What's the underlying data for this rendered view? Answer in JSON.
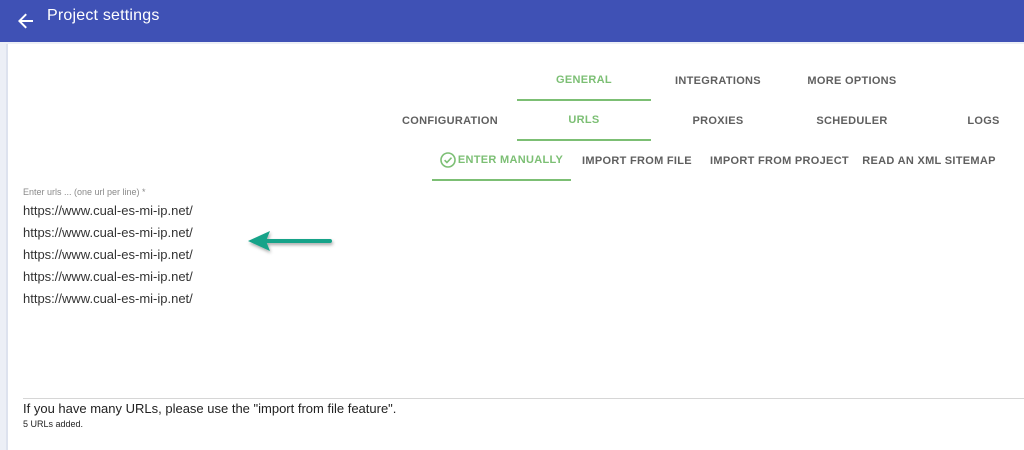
{
  "header": {
    "title": "Project settings",
    "bg_color": "#3f51b5"
  },
  "tabs_primary": [
    {
      "label": "GENERAL",
      "active": true
    },
    {
      "label": "INTEGRATIONS",
      "active": false
    },
    {
      "label": "MORE OPTIONS",
      "active": false
    }
  ],
  "tabs_secondary": [
    {
      "label": "CONFIGURATION",
      "active": false
    },
    {
      "label": "URLS",
      "active": true
    },
    {
      "label": "PROXIES",
      "active": false
    },
    {
      "label": "SCHEDULER",
      "active": false
    },
    {
      "label": "LOGS",
      "active": false
    }
  ],
  "tabs_tertiary": [
    {
      "label": "ENTER MANUALLY",
      "active": true,
      "icon": "check-circle-icon"
    },
    {
      "label": "IMPORT FROM FILE",
      "active": false
    },
    {
      "label": "IMPORT FROM PROJECT",
      "active": false
    },
    {
      "label": "READ AN XML SITEMAP",
      "active": false
    }
  ],
  "urls_field": {
    "label": "Enter urls ... (one url per line) *",
    "lines": [
      "https://www.cual-es-mi-ip.net/",
      "https://www.cual-es-mi-ip.net/",
      "https://www.cual-es-mi-ip.net/",
      "https://www.cual-es-mi-ip.net/",
      "https://www.cual-es-mi-ip.net/"
    ]
  },
  "annotation": {
    "icon": "arrow-left-icon",
    "color": "#14a389"
  },
  "footer": {
    "hint": "If you have many URLs, please use the \"import from file feature\".",
    "count": "5 URLs added."
  },
  "colors": {
    "accent_green": "#7cbf74",
    "tab_text": "#5f5f5f"
  }
}
